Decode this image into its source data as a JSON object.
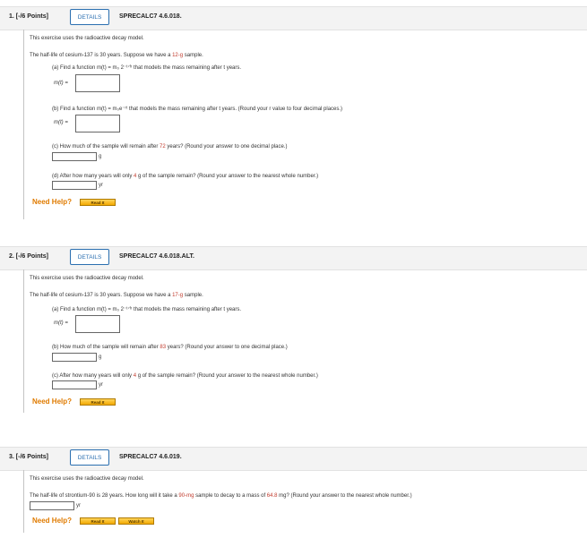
{
  "questions": [
    {
      "points": "1. [-/6 Points]",
      "details": "DETAILS",
      "code": "SPRECALC7 4.6.018.",
      "intro": "This exercise uses the radioactive decay model.",
      "stem_pre": "The half-life of cesium-137 is 30 years. Suppose we have a ",
      "stem_red": "12-g",
      "stem_post": " sample.",
      "parts": [
        {
          "text": "(a) Find a function  m(t) = m₀ 2⁻ᵗᐟʰ  that models the mass remaining after t years.",
          "answer_label": "m(t) ="
        },
        {
          "text": "(b) Find a function  m(t) = m₀e⁻ʳᵗ  that models the mass remaining after t years. (Round your r value to four decimal places.)",
          "answer_label": "m(t) ="
        },
        {
          "text_pre": "(c) How much of the sample will remain after ",
          "text_red": "72",
          "text_post": " years? (Round your answer to one decimal place.)",
          "unit": "g"
        },
        {
          "text_pre": "(d) After how many years will only ",
          "text_red": "4",
          "text_post": " g of the sample remain? (Round your answer to the nearest whole number.)",
          "unit": "yr"
        }
      ],
      "need_help": "Need Help?",
      "read_it": "Read It"
    },
    {
      "points": "2. [-/6 Points]",
      "details": "DETAILS",
      "code": "SPRECALC7 4.6.018.ALT.",
      "intro": "This exercise uses the radioactive decay model.",
      "stem_pre": "The half-life of cesium-137 is 30 years. Suppose we have a ",
      "stem_red": "17-g",
      "stem_post": " sample.",
      "parts": [
        {
          "text": "(a) Find a function  m(t) = m₀ 2⁻ᵗᐟʰ  that models the mass remaining after t years.",
          "answer_label": "m(t) ="
        },
        {
          "text_pre": "(b) How much of the sample will remain after ",
          "text_red": "83",
          "text_post": " years? (Round your answer to one decimal place.)",
          "unit": "g"
        },
        {
          "text_pre": "(c) After how many years will only ",
          "text_red": "4",
          "text_post": " g of the sample remain? (Round your answer to the nearest whole number.)",
          "unit": "yr"
        }
      ],
      "need_help": "Need Help?",
      "read_it": "Read It"
    },
    {
      "points": "3. [-/6 Points]",
      "details": "DETAILS",
      "code": "SPRECALC7 4.6.019.",
      "intro": "This exercise uses the radioactive decay model.",
      "stem_pre": "The half-life of strontium-90 is 28 years. How long will it take a ",
      "stem_red": "90-mg",
      "stem_mid": " sample to decay to a mass of ",
      "stem_red2": "64.8",
      "stem_post": " mg? (Round your answer to the nearest whole number.)",
      "unit": "yr",
      "need_help": "Need Help?",
      "read_it": "Read It",
      "watch_it": "Watch It"
    }
  ]
}
